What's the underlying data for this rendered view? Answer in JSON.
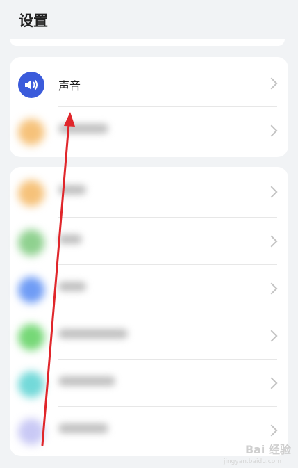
{
  "header": {
    "title": "设置"
  },
  "card1": {
    "rows": [
      {
        "label": "声音",
        "icon": "speaker-icon",
        "icon_color": "#3b5bdb"
      },
      {
        "label": "",
        "icon": "blurred-icon",
        "icon_color": "#f6c27a"
      }
    ]
  },
  "card2": {
    "rows": [
      {
        "icon_color": "#f6c27a"
      },
      {
        "icon_color": "#8fd18f"
      },
      {
        "icon_color": "#6f9cf5"
      },
      {
        "icon_color": "#76d877"
      },
      {
        "icon_color": "#73d9d9"
      },
      {
        "icon_color": "#c9c9f5"
      }
    ]
  },
  "annotation": {
    "type": "arrow",
    "color": "#e0262b"
  },
  "watermark": {
    "text": "Bai 经验",
    "sub": "jingyan.baidu.com"
  }
}
